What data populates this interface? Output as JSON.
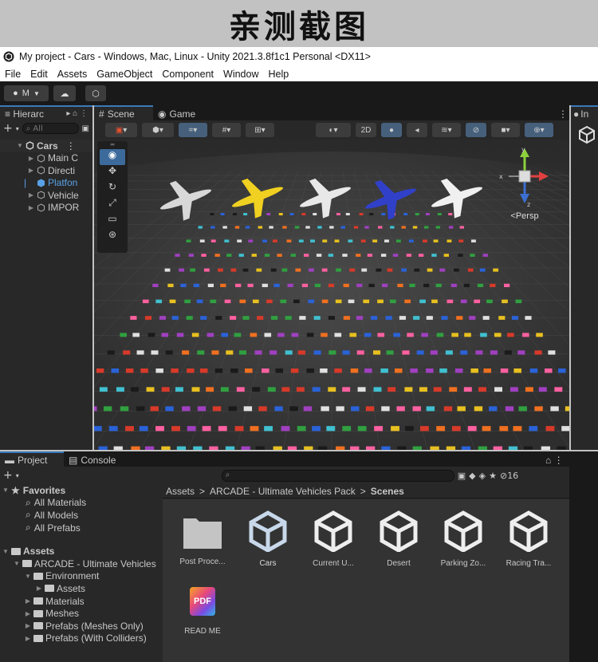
{
  "banner": {
    "text": "亲测截图"
  },
  "window": {
    "title": "My project - Cars - Windows, Mac, Linux - Unity 2021.3.8f1c1 Personal <DX11>"
  },
  "menu": [
    "File",
    "Edit",
    "Assets",
    "GameObject",
    "Component",
    "Window",
    "Help"
  ],
  "toolbar": {
    "account_label": "M"
  },
  "hierarchy": {
    "tab": "Hierarc",
    "search_placeholder": "All",
    "items": [
      {
        "label": "Cars",
        "indent": 0,
        "bold": true
      },
      {
        "label": "Main C",
        "indent": 1
      },
      {
        "label": "Directi",
        "indent": 1
      },
      {
        "label": "Platfon",
        "indent": 1,
        "highlight": true
      },
      {
        "label": "Vehicle",
        "indent": 1
      },
      {
        "label": "IMPOR",
        "indent": 1
      }
    ]
  },
  "scene": {
    "tabs": [
      "Scene",
      "Game"
    ],
    "toggle_2d": "2D",
    "gizmo": {
      "persp_label": "Persp",
      "x_label": "x",
      "y_label": "y",
      "z_label": "z"
    }
  },
  "inspector": {
    "tab": "In"
  },
  "project": {
    "tabs": [
      "Project",
      "Console"
    ],
    "badge": "16",
    "favorites": {
      "label": "Favorites",
      "items": [
        "All Materials",
        "All Models",
        "All Prefabs"
      ]
    },
    "tree": [
      {
        "label": "Assets",
        "indent": 0,
        "bold": true
      },
      {
        "label": "ARCADE - Ultimate Vehicles",
        "indent": 1
      },
      {
        "label": "Environment",
        "indent": 2
      },
      {
        "label": "Assets",
        "indent": 3
      },
      {
        "label": "Materials",
        "indent": 2
      },
      {
        "label": "Meshes",
        "indent": 2
      },
      {
        "label": "Prefabs (Meshes Only)",
        "indent": 2
      },
      {
        "label": "Prefabs (With Colliders)",
        "indent": 2
      }
    ],
    "breadcrumb": [
      "Assets",
      "ARCADE - Ultimate Vehicles Pack",
      "Scenes"
    ],
    "assets": [
      {
        "label": "Post Proce...",
        "icon": "folder-icon"
      },
      {
        "label": "Cars",
        "icon": "unity-scene-icon",
        "selected": true
      },
      {
        "label": "Current U...",
        "icon": "unity-scene-icon"
      },
      {
        "label": "Desert",
        "icon": "unity-scene-icon"
      },
      {
        "label": "Parking Zo...",
        "icon": "unity-scene-icon"
      },
      {
        "label": "Racing Tra...",
        "icon": "unity-scene-icon"
      },
      {
        "label": "READ ME",
        "icon": "pdf-icon",
        "icon_text": "PDF"
      }
    ]
  }
}
